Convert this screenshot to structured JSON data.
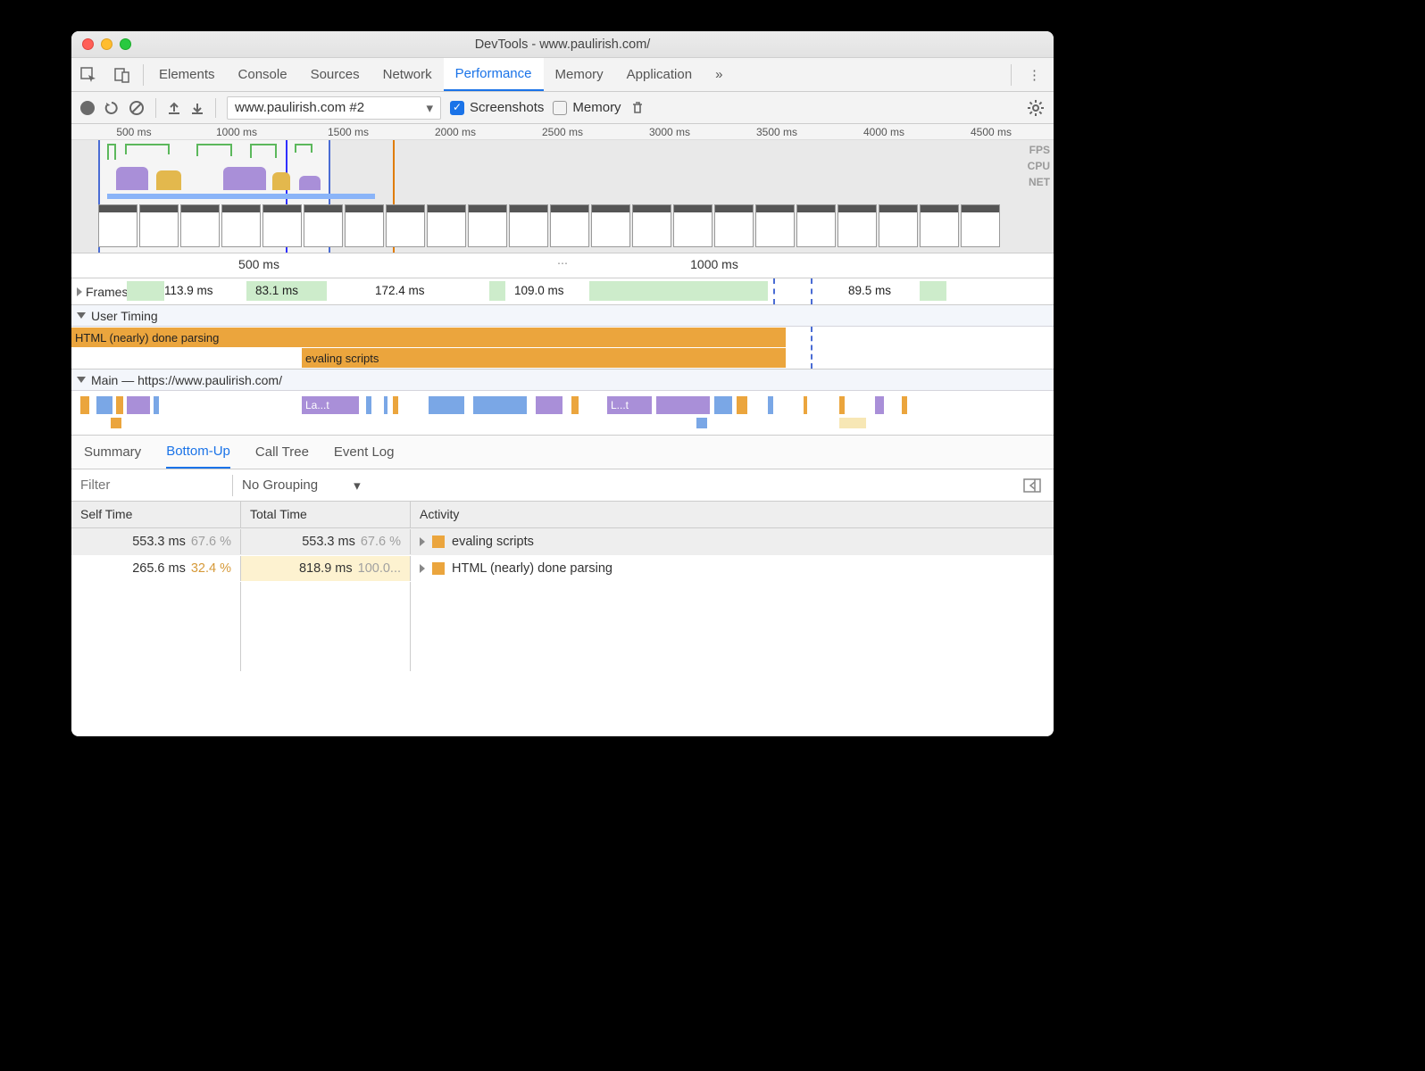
{
  "window": {
    "title": "DevTools - www.paulirish.com/"
  },
  "tabs": {
    "items": [
      "Elements",
      "Console",
      "Sources",
      "Network",
      "Performance",
      "Memory",
      "Application"
    ],
    "active": "Performance",
    "overflow": "»"
  },
  "toolbar": {
    "recording_select": "www.paulirish.com #2",
    "screenshots_label": "Screenshots",
    "screenshots_checked": true,
    "memory_label": "Memory",
    "memory_checked": false
  },
  "overview": {
    "ticks": [
      "500 ms",
      "1000 ms",
      "1500 ms",
      "2000 ms",
      "2500 ms",
      "3000 ms",
      "3500 ms",
      "4000 ms",
      "4500 ms"
    ],
    "track_labels": {
      "fps": "FPS",
      "cpu": "CPU",
      "net": "NET"
    }
  },
  "detail_ruler": {
    "ticks": [
      "500 ms",
      "1000 ms"
    ]
  },
  "frames": {
    "label": "Frames",
    "items": [
      "113.9 ms",
      "83.1 ms",
      "172.4 ms",
      "109.0 ms",
      "89.5 ms"
    ]
  },
  "user_timing": {
    "label": "User Timing",
    "bars": [
      {
        "label": "HTML (nearly) done parsing"
      },
      {
        "label": "evaling scripts"
      }
    ]
  },
  "main": {
    "label": "Main — https://www.paulirish.com/",
    "snippets": [
      "La...t",
      "L...t"
    ]
  },
  "detail_tabs": {
    "items": [
      "Summary",
      "Bottom-Up",
      "Call Tree",
      "Event Log"
    ],
    "active": "Bottom-Up"
  },
  "filter": {
    "placeholder": "Filter",
    "grouping": "No Grouping"
  },
  "table": {
    "headers": {
      "self": "Self Time",
      "total": "Total Time",
      "activity": "Activity"
    },
    "rows": [
      {
        "self_ms": "553.3 ms",
        "self_pct": "67.6 %",
        "total_ms": "553.3 ms",
        "total_pct": "67.6 %",
        "activity": "evaling scripts",
        "selected": true
      },
      {
        "self_ms": "265.6 ms",
        "self_pct": "32.4 %",
        "total_ms": "818.9 ms",
        "total_pct": "100.0...",
        "activity": "HTML (nearly) done parsing",
        "selected": false
      }
    ]
  }
}
